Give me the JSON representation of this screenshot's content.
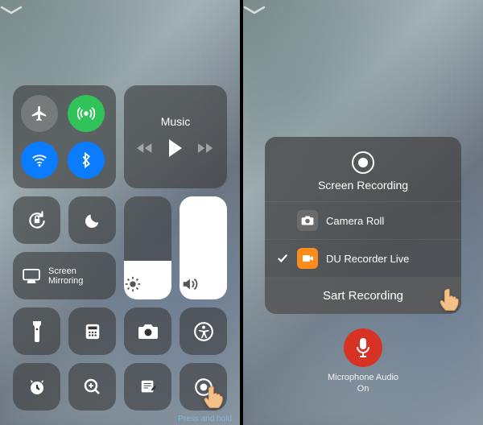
{
  "left": {
    "music_label": "Music",
    "mirroring_label": "Screen\nMirroring",
    "hint": "Press and hold"
  },
  "right": {
    "popover": {
      "title": "Screen Recording",
      "options": [
        {
          "label": "Camera Roll",
          "selected": false
        },
        {
          "label": "DU Recorder Live",
          "selected": true
        }
      ],
      "start_label": "Sart Recording"
    },
    "mic": {
      "label_line1": "Microphone Audio",
      "label_line2": "On"
    }
  }
}
